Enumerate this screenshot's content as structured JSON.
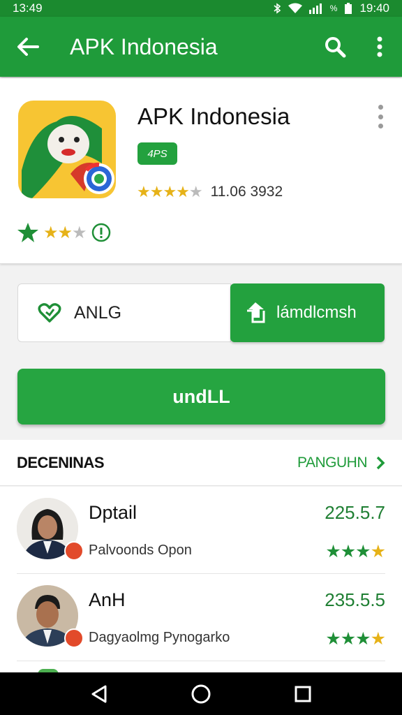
{
  "status_bar": {
    "time": "13:49",
    "right_text": "19:40",
    "battery_percent_symbol": "%"
  },
  "app_bar": {
    "title": "APK Indonesia",
    "icons": [
      "arrow-back-icon",
      "search-icon",
      "more-vert-icon"
    ]
  },
  "app": {
    "name": "APK Indonesia",
    "badge": "4PS",
    "rating_count": "11.06 3932",
    "rating_stars": 4,
    "mini_rating_stars": 2
  },
  "buttons": {
    "outline_label": "ANLG",
    "filled_label": "lámdlcmsh",
    "install_label": "undLL"
  },
  "section": {
    "title": "DECENINAS",
    "link": "PANGUHN"
  },
  "list": [
    {
      "name": "Dptail",
      "subtitle": "Palvoonds Opon",
      "value": "225.5.7",
      "stars": "★★★★"
    },
    {
      "name": "AnH",
      "subtitle": "Dagyaolmg Pynogarko",
      "value": "235.5.5",
      "stars": "★★★★"
    }
  ],
  "colors": {
    "primary": "#1f9b3a",
    "status_bar": "#1b8a2f",
    "star_gold": "#e6b218",
    "star_green": "#1f8f37"
  }
}
